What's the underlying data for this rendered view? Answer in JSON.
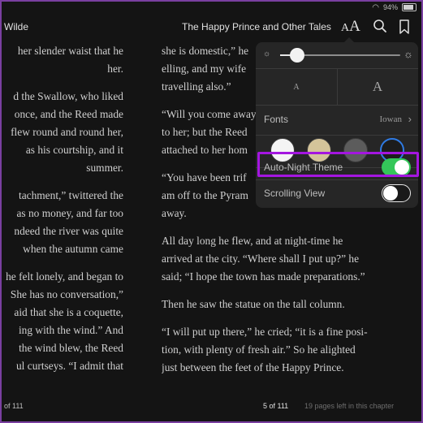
{
  "status_bar": {
    "battery_text": "94%"
  },
  "toolbar": {
    "author": "Wilde",
    "book_title": "The Happy Prince and Other Tales",
    "aa_small": "A",
    "aa_large": "A"
  },
  "left_page_lines": [
    [
      "her slender waist that he",
      "her."
    ],
    [
      "d the Swallow, who liked",
      "once, and the Reed made",
      "flew round and round her,",
      "as his courtship, and it",
      "summer."
    ],
    [
      "tachment,” twittered the",
      "as no money, and far too",
      "ndeed the river was quite",
      "when the autumn came"
    ],
    [
      "he felt lonely, and began to",
      "She has no conversation,”",
      "aid that she is a coquette,",
      "ing with the wind.”  And",
      "the wind blew, the Reed",
      "ul curtseys.  “I admit that"
    ]
  ],
  "right_page_lines": [
    [
      "she is domestic,” he",
      "elling, and my wife",
      "travelling also.”"
    ],
    [
      "“Will you come away",
      "to her; but the Reed",
      "attached to her hom"
    ],
    [
      "“You have been trif",
      "am off to the Pyram",
      "away."
    ],
    [
      "All day long he flew, and at night-time he",
      "arrived at the city.  “Where shall I put up?” he",
      "said; “I hope the town has made preparations.”"
    ],
    [
      "Then he saw the statue on the tall column."
    ],
    [
      "“I will put up there,” he cried; “it is a fine posi-",
      "tion, with plenty of fresh air.”  So he alighted",
      "just between the feet of the Happy Prince."
    ]
  ],
  "footer": {
    "left_page_number": "of 111",
    "right_page_number": "5 of 111",
    "pages_left": "19 pages left in this chapter"
  },
  "popover": {
    "brightness_level": 0.14,
    "text_size_small": "A",
    "text_size_large": "A",
    "fonts_label": "Fonts",
    "fonts_value": "Iowan",
    "themes": [
      {
        "name": "white",
        "color": "#f4f4f4"
      },
      {
        "name": "sepia",
        "color": "#d4c49a"
      },
      {
        "name": "gray",
        "color": "#5c5c5c"
      },
      {
        "name": "night",
        "color": "#1c1c1c",
        "selected": true
      }
    ],
    "auto_night_label": "Auto-Night Theme",
    "auto_night_on": true,
    "scrolling_label": "Scrolling View",
    "scrolling_on": false
  },
  "colors": {
    "accent_blue": "#2f7be5",
    "toggle_on": "#34c759",
    "highlight": "#a416e0"
  }
}
